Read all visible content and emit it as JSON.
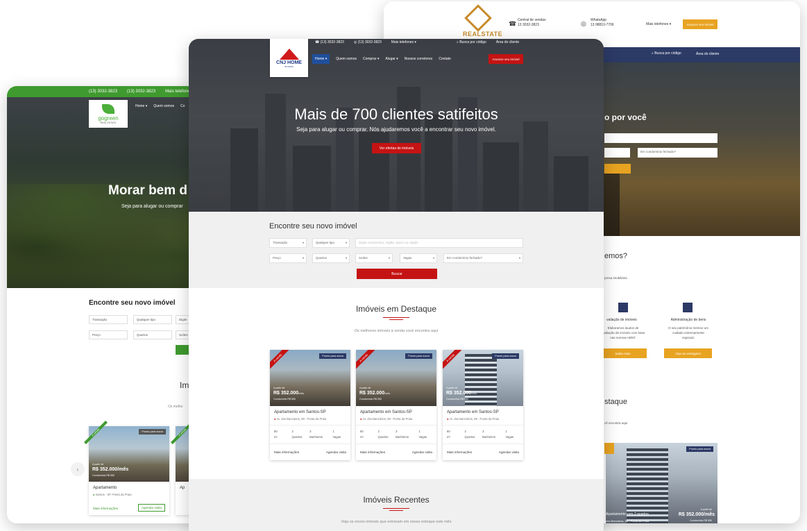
{
  "left": {
    "topbar": [
      "(13) 3032-3823",
      "(13) 3032-3823",
      "Mais telefones"
    ],
    "logo": {
      "name": "gogreen",
      "sub": "REAL ESTATE"
    },
    "nav": [
      "Home ▾",
      "Quem somos",
      "Co"
    ],
    "hero_title": "Morar bem d",
    "hero_sub": "Seja para alugar ou comprar",
    "search_title": "Encontre seu novo imóvel",
    "selects": [
      "Transação",
      "Qualquer tipo",
      "Digite",
      "Preço",
      "Quartos",
      "Suítes"
    ],
    "feat_title": "Im",
    "feat_sub": "Os melho",
    "card": {
      "tag": "Pronto para morar",
      "ribbon": "À venda",
      "prefix": "A partir de",
      "price": "R$ 352.000/mês",
      "cond": "Condomínio R$ 550",
      "title": "Apartamento",
      "addr": "Santos - SP, Ponta da Praia",
      "more": "Mais informações",
      "visit": "Agendar visita"
    },
    "card2_title": "Ap",
    "arrow": "‹"
  },
  "right": {
    "logo": "REALSTATE",
    "contact1": {
      "label": "Central de vendas",
      "phone": "13 3032-3823"
    },
    "contact2": {
      "label": "WhatsApp",
      "phone": "13 98810-7706"
    },
    "more_phones": "Mais telefones ▾",
    "anuncie": "Anuncie seu imóvel",
    "nav": [
      "Busca por código",
      "Área do cliente"
    ],
    "hero_title": "o por você",
    "inputs": [
      "Em condomínio fechado?"
    ],
    "about_title": "emos?",
    "about_sub": "presa imobiliária",
    "services": [
      {
        "title": "valiação de imóveis",
        "text": "Elaboramos laudos de\navaliação de imóveis com base\nnas normas ABNT.",
        "btn": "Saiba mais"
      },
      {
        "title": "Administração de bens",
        "text": "O seu patrimônio merece um\ncuidado extremamente\nespecial.",
        "btn": "Veja as vantagens"
      }
    ],
    "dest_title": "staque",
    "dest_sub": "cê encontra aqui",
    "card": {
      "tag": "Pronto para morar",
      "title": "Apartamento com 2 quartos",
      "addr": "dos Bancários, 98 - Ponta da Praia",
      "prefix": "A partir de",
      "price": "R$ 352.000/mês",
      "cond": "Condomínio R$ 550"
    }
  },
  "center": {
    "topbar": [
      "(13) 3032-3823",
      "(13) 3032-3823",
      "Mais telefones ▾"
    ],
    "topbar_right": [
      "Busca por código",
      "Área do cliente"
    ],
    "logo": {
      "name": "CNJ HOME",
      "sub": "BUYERS"
    },
    "nav": [
      "Home ▾",
      "Quem somos",
      "Comprar ▾",
      "Alugar ▾",
      "Nossos corretores",
      "Contato"
    ],
    "anuncie": "Anuncie seu imóvel",
    "hero_title": "Mais de 700 clientes satifeitos",
    "hero_sub": "Seja para alugar ou comprar. Nós ajudaremos você a encontrar seu novo imóvel.",
    "hero_btn": "Ver ofertas de imóveis",
    "search_title": "Encontre seu novo imóvel",
    "search": {
      "transacao": "Transação",
      "tipo": "Qualquer tipo",
      "busca_placeholder": "Digite condomínio, região, bairro ou cidade",
      "preco": "Preço",
      "quartos": "Quartos",
      "suites": "Suítes",
      "vagas": "Vagas",
      "condominio": "Em condomínio fechado?",
      "buscar": "Buscar"
    },
    "dest_title": "Imóveis em Destaque",
    "dest_sub": "Os melhores imóveis à venda você encontra aqui",
    "cards": [
      {
        "tag": "Pronto para morar",
        "ribbon": "À venda",
        "prefix": "A partir de",
        "price": "R$ 352.000",
        "unit": "/mês",
        "cond": "Condomínio R$ 550",
        "title": "Apartamento em Santos-SP",
        "addr": "Av. dos Bancários, 98 - Ponta da Praia",
        "specs": [
          {
            "v": "80",
            "l": "m²"
          },
          {
            "v": "2",
            "l": "Quartos"
          },
          {
            "v": "3",
            "l": "Banheiros"
          },
          {
            "v": "1",
            "l": "Vagas"
          }
        ],
        "more": "Mais informações",
        "visit": "Agendar visita"
      },
      {
        "tag": "Pronto para morar",
        "ribbon": "À venda",
        "prefix": "A partir de",
        "price": "R$ 352.000",
        "unit": "/mês",
        "cond": "Condomínio R$ 550",
        "title": "Apartamento em Santos-SP",
        "addr": "Av. dos Bancários, 98 - Ponta da Praia",
        "specs": [
          {
            "v": "80",
            "l": "m²"
          },
          {
            "v": "2",
            "l": "Quartos"
          },
          {
            "v": "3",
            "l": "Banheiros"
          },
          {
            "v": "1",
            "l": "Vagas"
          }
        ],
        "more": "Mais informações",
        "visit": "Agendar visita"
      },
      {
        "tag": "Pronto para morar",
        "ribbon": "À venda",
        "prefix": "A partir de",
        "price": "R$ 352.000",
        "unit": "/mês",
        "cond": "Condomínio R$ 550",
        "title": "Apartamento em Santos-SP",
        "addr": "Av. dos Bancários, 98 - Ponta da Praia",
        "specs": [
          {
            "v": "80",
            "l": "m²"
          },
          {
            "v": "2",
            "l": "Quartos"
          },
          {
            "v": "3",
            "l": "Banheiros"
          },
          {
            "v": "1",
            "l": "Vagas"
          }
        ],
        "more": "Mais informações",
        "visit": "Agendar visita"
      }
    ],
    "rec_title": "Imóveis Recentes",
    "rec_sub": "Veja os novos imóveis que entraram em nosso estoque este mês"
  },
  "colors": {
    "cnj_red": "#c51313",
    "cnj_blue": "#1f4f9c",
    "gogreen": "#3f9a2f",
    "realstate_navy": "#2c3a66",
    "realstate_gold": "#e8a321"
  }
}
